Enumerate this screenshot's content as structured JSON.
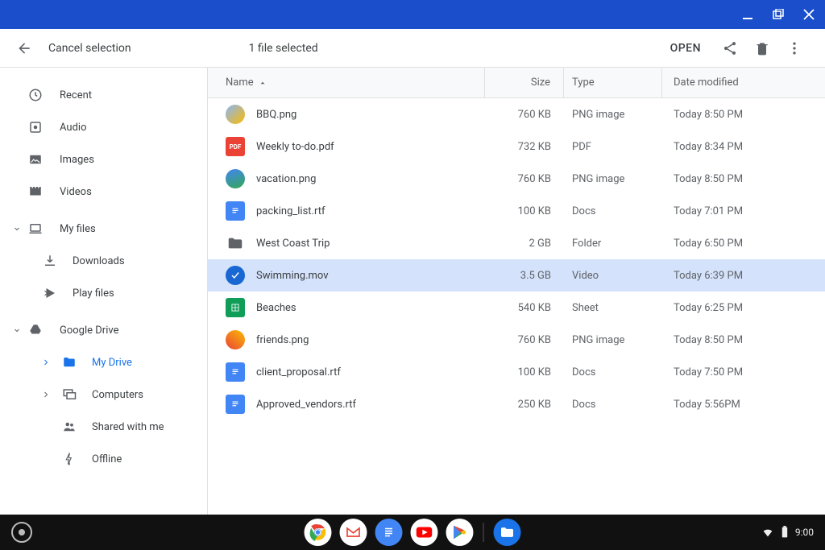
{
  "titlebar": {},
  "toolbar": {
    "cancel_label": "Cancel selection",
    "selection_count": "1 file selected",
    "open_label": "OPEN"
  },
  "sidebar": {
    "recent": "Recent",
    "audio": "Audio",
    "images": "Images",
    "videos": "Videos",
    "my_files": "My files",
    "downloads": "Downloads",
    "play_files": "Play files",
    "google_drive": "Google Drive",
    "my_drive": "My Drive",
    "computers": "Computers",
    "shared": "Shared with me",
    "offline": "Offline"
  },
  "columns": {
    "name": "Name",
    "size": "Size",
    "type": "Type",
    "date": "Date modified"
  },
  "files": [
    {
      "name": "BBQ.png",
      "size": "760 KB",
      "type": "PNG image",
      "date": "Today 8:50 PM",
      "icon": "thumb",
      "selected": false
    },
    {
      "name": "Weekly to-do.pdf",
      "size": "732 KB",
      "type": "PDF",
      "date": "Today 8:34 PM",
      "icon": "pdf",
      "selected": false
    },
    {
      "name": "vacation.png",
      "size": "760 KB",
      "type": "PNG image",
      "date": "Today 8:50 PM",
      "icon": "thumb2",
      "selected": false
    },
    {
      "name": "packing_list.rtf",
      "size": "100 KB",
      "type": "Docs",
      "date": "Today 7:01 PM",
      "icon": "doc",
      "selected": false
    },
    {
      "name": "West Coast Trip",
      "size": "2 GB",
      "type": "Folder",
      "date": "Today 6:50 PM",
      "icon": "folder",
      "selected": false
    },
    {
      "name": "Swimming.mov",
      "size": "3.5 GB",
      "type": "Video",
      "date": "Today 6:39 PM",
      "icon": "check",
      "selected": true
    },
    {
      "name": "Beaches",
      "size": "540 KB",
      "type": "Sheet",
      "date": "Today 6:25 PM",
      "icon": "sheet",
      "selected": false
    },
    {
      "name": "friends.png",
      "size": "760 KB",
      "type": "PNG image",
      "date": "Today 8:50 PM",
      "icon": "thumb3",
      "selected": false
    },
    {
      "name": "client_proposal.rtf",
      "size": "100 KB",
      "type": "Docs",
      "date": "Today 7:50 PM",
      "icon": "doc",
      "selected": false
    },
    {
      "name": "Approved_vendors.rtf",
      "size": "250 KB",
      "type": "Docs",
      "date": "Today 5:56PM",
      "icon": "doc",
      "selected": false
    }
  ],
  "shelf": {
    "time": "9:00"
  }
}
